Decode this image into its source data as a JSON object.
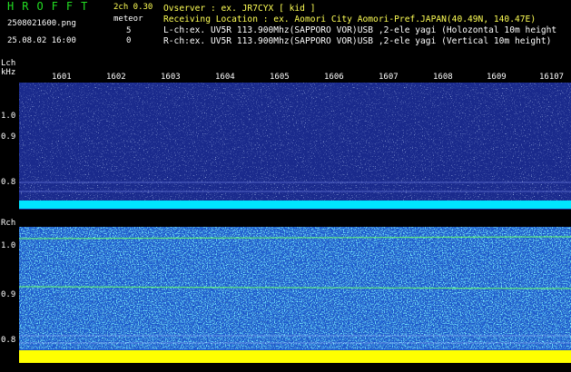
{
  "header": {
    "logo": "HROFFT",
    "filename": "2508021600.png",
    "timestamp": "25.08.02 16:00",
    "version": "2ch 0.30",
    "meteor_label": "meteor",
    "counts": [
      "5",
      "0"
    ],
    "observer": "Ovserver          : ex. JR7CYX [ kid ]",
    "location": "Receiving Location : ex. Aomori City Aomori-Pref.JAPAN(40.49N, 140.47E)",
    "lch": "L-ch:ex. UV5R 113.900Mhz(SAPPORO VOR)USB ,2-ele yagi (Holozontal 10m height",
    "rch": "R-ch:ex. UV5R 113.900Mhz(SAPPORO VOR)USB ,2-ele yagi (Vertical 10m height)"
  },
  "lch_panel": {
    "label": "Lch",
    "unit": "kHz",
    "yticks": [
      "1.0",
      "0.9",
      "0.8"
    ],
    "time_ticks": [
      "1601",
      "1602",
      "1603",
      "1604",
      "1605",
      "1606",
      "1607",
      "1608",
      "1609",
      "16107"
    ]
  },
  "rch_panel": {
    "label": "Rch",
    "yticks": [
      "1.0",
      "0.9",
      "0.8"
    ]
  },
  "colors": {
    "background": "#000000",
    "lch_fill": "#1a2a8c",
    "rch_fill": "#1a55cc",
    "cyan_band": "#00e5ff",
    "yellow_band": "#ffff00",
    "logo": "#22dd22"
  }
}
